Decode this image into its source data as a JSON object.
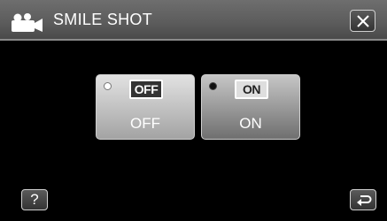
{
  "header": {
    "title": "SMILE SHOT",
    "mode_icon": "movie-camera-icon",
    "close_icon": "close-icon"
  },
  "options": [
    {
      "id": "off",
      "badge": "OFF",
      "label": "OFF",
      "selected": false
    },
    {
      "id": "on",
      "badge": "ON",
      "label": "ON",
      "selected": true
    }
  ],
  "footer": {
    "help_label": "?",
    "back_icon": "return-icon"
  },
  "colors": {
    "background": "#000000",
    "header": "#5d5d5d",
    "option_face": "#c0c0c0",
    "text": "#ffffff"
  }
}
